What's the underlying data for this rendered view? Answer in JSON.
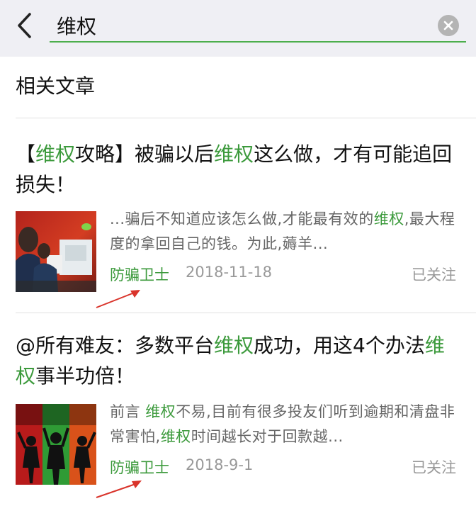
{
  "search": {
    "query": "维权",
    "back_icon": "chevron-left-icon",
    "clear_icon": "clear-circle-icon"
  },
  "section": {
    "title": "相关文章"
  },
  "highlight_color": "#3c9a3c",
  "accent_line_color": "#4cae4c",
  "articles": [
    {
      "title_parts": [
        "【",
        "维权",
        "攻略】被骗以后",
        "维权",
        "这么做，才有可能追回损失！"
      ],
      "excerpt_parts": [
        "...骗后不知道应该怎么做,才能最有效的",
        "维权",
        ",最大程度的拿回自己的钱。为此,薅羊..."
      ],
      "source": "防骗卫士",
      "date": "2018-11-18",
      "follow": "已关注"
    },
    {
      "title_parts": [
        "@所有难友：多数平台",
        "维权",
        "成功，用这4个办法",
        "维权",
        "事半功倍！"
      ],
      "excerpt_parts": [
        "前言 ",
        "维权",
        "不易,目前有很多投友们听到逾期和清盘非常害怕,",
        "维权",
        "时间越长对于回款越..."
      ],
      "source": "防骗卫士",
      "date": "2018-9-1",
      "follow": "已关注"
    }
  ]
}
